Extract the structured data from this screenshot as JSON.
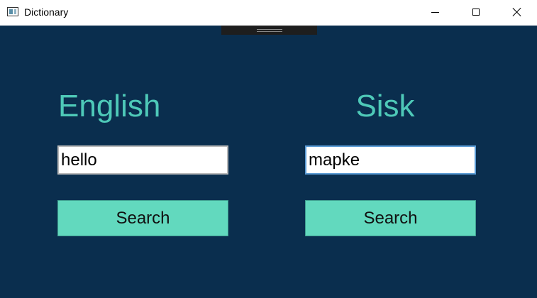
{
  "window": {
    "title": "Dictionary"
  },
  "colors": {
    "background": "#0a2e4e",
    "heading": "#4ec9b8",
    "button": "#62d9be"
  },
  "icons": {
    "app": "app-window-icon",
    "minimize": "minimize-icon",
    "maximize": "maximize-icon",
    "close": "close-icon"
  },
  "english": {
    "heading": "English",
    "input_value": "hello",
    "search_label": "Search"
  },
  "sisk": {
    "heading": "Sisk",
    "input_value": "mapke",
    "search_label": "Search"
  }
}
